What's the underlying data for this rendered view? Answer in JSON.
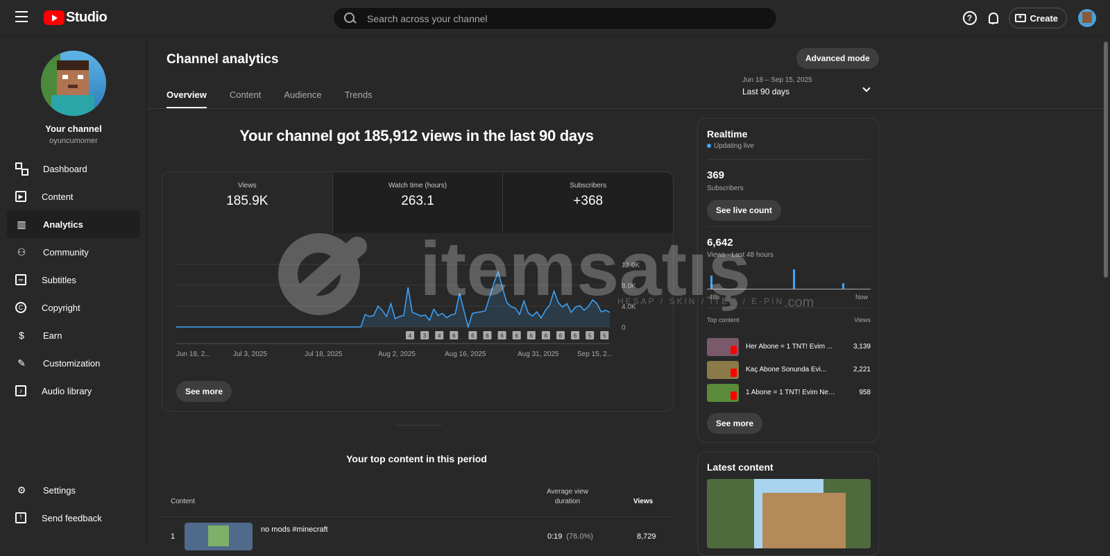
{
  "header": {
    "logo_text": "Studio",
    "search_placeholder": "Search across your channel",
    "help_icon": "?",
    "create_label": "Create"
  },
  "sidebar": {
    "channel_name": "Your channel",
    "channel_handle": "oyuncumomer",
    "items": [
      {
        "label": "Dashboard",
        "icon": "dashboard-icon"
      },
      {
        "label": "Content",
        "icon": "content-icon"
      },
      {
        "label": "Analytics",
        "icon": "analytics-icon",
        "active": true
      },
      {
        "label": "Community",
        "icon": "community-icon"
      },
      {
        "label": "Subtitles",
        "icon": "subtitles-icon"
      },
      {
        "label": "Copyright",
        "icon": "copyright-icon"
      },
      {
        "label": "Earn",
        "icon": "earn-icon"
      },
      {
        "label": "Customization",
        "icon": "customization-icon"
      },
      {
        "label": "Audio library",
        "icon": "audio-library-icon"
      }
    ],
    "bottom_items": [
      {
        "label": "Settings",
        "icon": "settings-icon"
      },
      {
        "label": "Send feedback",
        "icon": "feedback-icon"
      }
    ]
  },
  "main": {
    "title": "Channel analytics",
    "advanced_mode_label": "Advanced mode",
    "tabs": [
      {
        "label": "Overview",
        "active": true
      },
      {
        "label": "Content"
      },
      {
        "label": "Audience"
      },
      {
        "label": "Trends"
      }
    ],
    "date_range": {
      "range": "Jun 18 – Sep 15, 2025",
      "label": "Last 90 days"
    },
    "headline": "Your channel got 185,912 views in the last 90 days",
    "metrics": [
      {
        "label": "Views",
        "value": "185.9K"
      },
      {
        "label": "Watch time (hours)",
        "value": "263.1"
      },
      {
        "label": "Subscribers",
        "value": "+368"
      }
    ],
    "see_more_label": "See more",
    "top_content": {
      "title": "Your top content in this period",
      "col_content": "Content",
      "col_avd": "Average view duration",
      "col_views": "Views",
      "rows": [
        {
          "rank": "1",
          "title": "no mods #minecraft",
          "duration": "0:19",
          "percent": "(76.0%)",
          "views": "8,729"
        }
      ]
    }
  },
  "chart_data": {
    "type": "line",
    "x_tick_labels": [
      "Jun 18, 2...",
      "Jul 3, 2025",
      "Jul 18, 2025",
      "Aug 2, 2025",
      "Aug 16, 2025",
      "Aug 31, 2025",
      "Sep 15, 2..."
    ],
    "y_tick_labels": [
      "12.0K",
      "8.0K",
      "4.0K",
      "0"
    ],
    "ylim": [
      0,
      12000
    ],
    "series": [
      {
        "values": [
          0,
          0,
          0,
          0,
          0,
          0,
          0,
          0,
          0,
          0,
          0,
          0,
          0,
          0,
          0,
          0,
          0,
          0,
          0,
          0,
          0,
          0,
          0,
          0,
          0,
          0,
          0,
          0,
          0,
          0,
          0,
          0,
          0,
          0,
          0,
          0,
          0,
          0,
          0,
          0,
          0,
          0,
          0,
          0,
          2400,
          2000,
          2200,
          4000,
          3200,
          2000,
          4500,
          1600,
          2000,
          2200,
          7600,
          2800,
          2500,
          2100,
          2300,
          1300,
          3400,
          2200,
          2600,
          1800,
          2300,
          2500,
          6500,
          3200,
          0,
          2600,
          2800,
          2900,
          3100,
          5700,
          8400,
          10600,
          7500,
          4700,
          3900,
          3600,
          2400,
          5000,
          2700,
          2100,
          2900,
          1700,
          3200,
          4200,
          6900,
          4700,
          3800,
          4500,
          2800,
          3800,
          4100,
          3200,
          3900,
          5200,
          4500,
          2900,
          3200,
          2800
        ]
      }
    ],
    "markers": [
      "4",
      "3",
      "4",
      "6",
      "6",
      "6",
      "6",
      "6",
      "6",
      "6",
      "6",
      "6",
      "5",
      "5"
    ],
    "colors": {
      "line": "#3ea6ff",
      "fill": "#3ea6ff"
    },
    "grid": true
  },
  "realtime": {
    "title": "Realtime",
    "status": "Updating live",
    "subscribers": "369",
    "subscribers_label": "Subscribers",
    "see_live_count_label": "See live count",
    "views": "6,642",
    "views_label": "Views · Last 48 hours",
    "bars_axis_start": "-48h",
    "bars_axis_end": "Now",
    "top_content_label": "Top content",
    "views_col_label": "Views",
    "top_items": [
      {
        "title": "Her Abone = 1 TNT! Evim ...",
        "views": "3,139",
        "thumb_color": "#7a5a6a"
      },
      {
        "title": "Kaç Abone Sonunda Evi...",
        "views": "2,221",
        "thumb_color": "#8a7a4a"
      },
      {
        "title": "1 Abone = 1 TNT! Evim Ne ...",
        "views": "958",
        "thumb_color": "#5a8a3a"
      }
    ],
    "see_more_label": "See more"
  },
  "latest_content": {
    "title": "Latest content"
  },
  "watermark": {
    "text": "itemsatış",
    "subtext": "HESAP / SKIN / ITEM / E-PIN",
    "domain": ".com"
  }
}
